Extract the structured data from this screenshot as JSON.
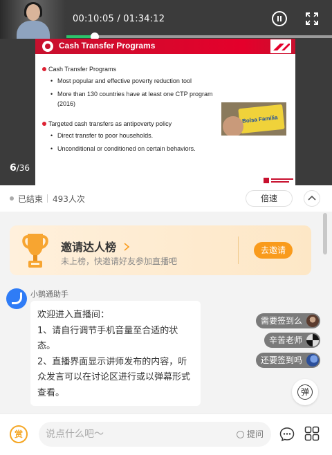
{
  "player": {
    "time_current": "00:10:05",
    "time_total": "01:34:12",
    "time_separator": " / ",
    "progress_fraction": 0.107,
    "page_current": "6",
    "page_total": "/36"
  },
  "slide": {
    "title": "Cash Transfer Programs",
    "section1": "Cash Transfer Programs",
    "bullets1": [
      "Most popular and effective poverty reduction tool",
      "More than 130 countries have at least one CTP program (2016)"
    ],
    "section2": "Targeted cash transfers as antipoverty policy",
    "bullets2": [
      "Direct transfer to poor households.",
      "Unconditional or conditioned on certain behaviors."
    ],
    "card_text": "Bolsa Família"
  },
  "infobar": {
    "status": "已结束",
    "views": "493人次",
    "speed_label": "倍速"
  },
  "invite": {
    "title": "邀请达人榜",
    "subtitle": "未上榜，快邀请好友参加直播吧",
    "button": "去邀请"
  },
  "message": {
    "sender": "小鹅通助手",
    "lines": [
      "欢迎进入直播间：",
      "1、请自行调节手机音量至合适的状态。",
      "2、直播界面显示讲师发布的内容，听众发言可以在讨论区进行或以弹幕形式查看。"
    ]
  },
  "tags": [
    "需要签到么",
    "辛苦老师",
    "还要签到吗"
  ],
  "danmu_label": "弹",
  "bottom": {
    "reward_label": "赏",
    "input_placeholder": "说点什么吧～",
    "ask_label": "提问"
  },
  "colors": {
    "accent_green": "#2cc36b",
    "brand_red": "#e4002b",
    "orange": "#f99b1c",
    "bot_blue": "#2f7cf6"
  }
}
